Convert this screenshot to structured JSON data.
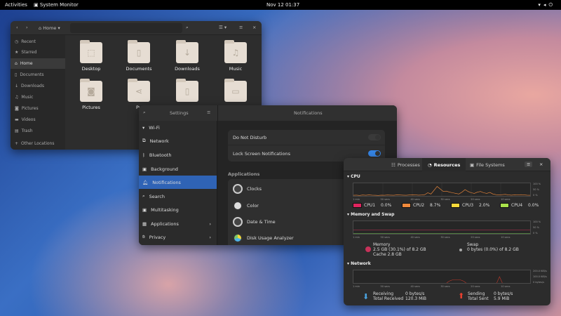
{
  "topbar": {
    "activities": "Activities",
    "app": "System Monitor",
    "clock": "Nov 12  01:37",
    "status_icons": [
      "wifi-icon",
      "volume-icon",
      "power-icon"
    ]
  },
  "files": {
    "location": "Home",
    "sidebar": [
      "Recent",
      "Starred",
      "Home",
      "Documents",
      "Downloads",
      "Music",
      "Pictures",
      "Videos",
      "Trash",
      "Other Locations"
    ],
    "selected": "Home",
    "folders": [
      {
        "name": "Desktop",
        "icon": "desktop-icon"
      },
      {
        "name": "Documents",
        "icon": "document-icon"
      },
      {
        "name": "Downloads",
        "icon": "download-icon"
      },
      {
        "name": "Music",
        "icon": "music-icon"
      },
      {
        "name": "Pictures",
        "icon": "camera-icon"
      },
      {
        "name": "Pu",
        "icon": "share-icon"
      },
      {
        "name": "",
        "icon": "template-icon"
      },
      {
        "name": "",
        "icon": "video-icon"
      }
    ]
  },
  "settings": {
    "title": "Settings",
    "panel_title": "Notifications",
    "sidebar": [
      {
        "label": "Wi-Fi"
      },
      {
        "label": "Network"
      },
      {
        "label": "Bluetooth"
      },
      {
        "label": "Background"
      },
      {
        "label": "Notifications"
      },
      {
        "label": "Search"
      },
      {
        "label": "Multitasking"
      },
      {
        "label": "Applications",
        "chevron": true
      },
      {
        "label": "Privacy",
        "chevron": true
      }
    ],
    "selected": "Notifications",
    "do_not_disturb": {
      "label": "Do Not Disturb",
      "on": false
    },
    "lock_screen": {
      "label": "Lock Screen Notifications",
      "on": true
    },
    "apps_header": "Applications",
    "apps": [
      "Clocks",
      "Color",
      "Date & Time",
      "Disk Usage Analyzer"
    ]
  },
  "sysmon": {
    "tabs": [
      "Processes",
      "Resources",
      "File Systems"
    ],
    "active_tab": "Resources",
    "cpu": {
      "label": "CPU",
      "cores": [
        {
          "name": "CPU1",
          "value": "0.0%",
          "color": "#e0245e"
        },
        {
          "name": "CPU2",
          "value": "8.7%",
          "color": "#f08a3c"
        },
        {
          "name": "CPU3",
          "value": "2.0%",
          "color": "#f5d93a"
        },
        {
          "name": "CPU4",
          "value": "0.0%",
          "color": "#a9e34b"
        }
      ],
      "history": [
        5,
        6,
        4,
        7,
        5,
        8,
        6,
        5,
        4,
        6,
        5,
        7,
        6,
        5,
        8,
        7,
        6,
        5,
        7,
        9,
        8,
        6,
        7,
        10,
        25,
        15,
        45,
        75,
        55,
        35,
        38,
        30,
        25,
        20,
        15,
        30,
        50,
        35,
        25,
        20,
        30,
        35,
        25,
        20,
        28,
        15,
        10,
        8,
        10,
        12,
        8,
        6,
        9,
        7,
        10,
        8,
        6,
        5
      ]
    },
    "time_axis": [
      "1 min",
      "50 secs",
      "40 secs",
      "30 secs",
      "20 secs",
      "10 secs"
    ],
    "y_axis_pct": [
      "100 %",
      "50 %",
      "0 %"
    ],
    "memory": {
      "label": "Memory and Swap",
      "mem_title": "Memory",
      "mem_value": "2.5 GB (30.1%) of 8.2 GB",
      "cache": "Cache 2.8 GB",
      "swap_title": "Swap",
      "swap_value": "0 bytes (0.0%) of 8.2 GB",
      "mem_color": "#c7325a"
    },
    "network": {
      "label": "Network",
      "y_axis": [
        "200.0 KiB/s",
        "100.0 KiB/s",
        "0 bytes/s"
      ],
      "receiving_label": "Receiving",
      "receiving": "0 bytes/s",
      "total_received_label": "Total Received",
      "total_received": "120.3 MiB",
      "sending_label": "Sending",
      "sending": "0 bytes/s",
      "total_sent_label": "Total Sent",
      "total_sent": "5.9 MiB"
    }
  }
}
